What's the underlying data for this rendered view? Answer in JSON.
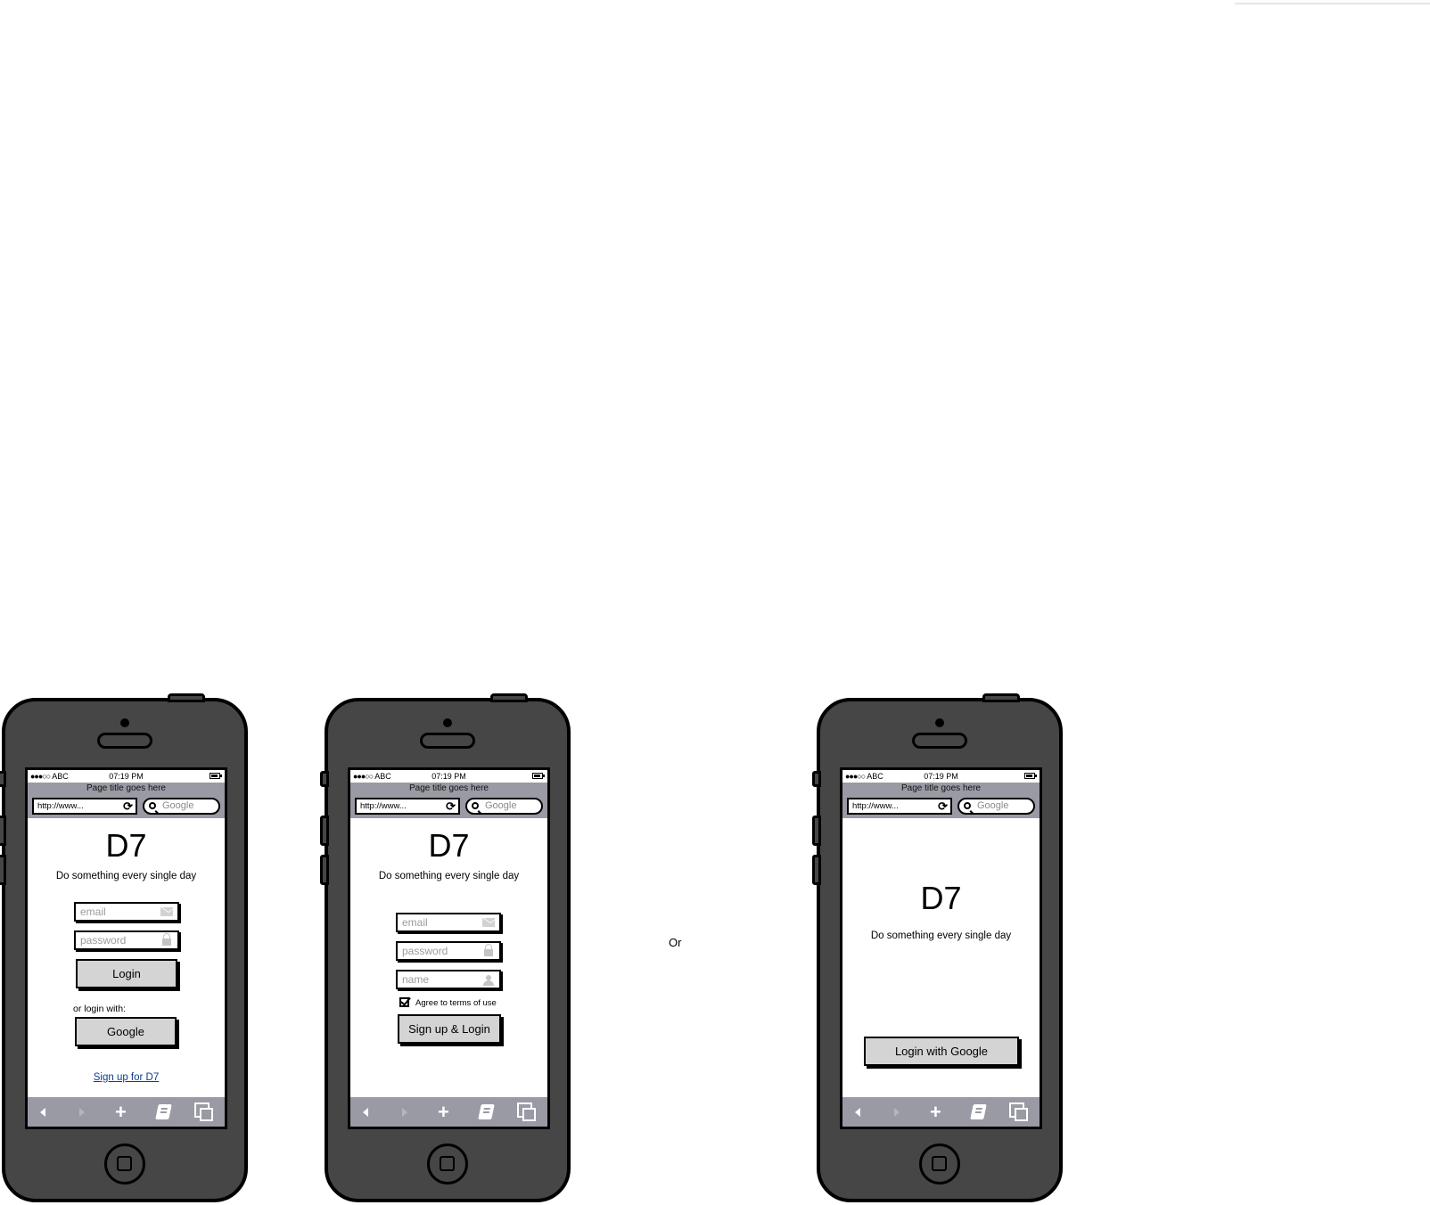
{
  "browser": {
    "carrier": "ABC",
    "signal": "●●●○○",
    "time": "07:19 PM",
    "page_title": "Page title goes here",
    "url": "http://www...",
    "search_placeholder": "Google"
  },
  "app": {
    "logo": "D7",
    "tagline": "Do something every single day"
  },
  "login_screen": {
    "email_placeholder": "email",
    "password_placeholder": "password",
    "login_label": "Login",
    "alt_login_text": "or login with:",
    "google_label": "Google",
    "signup_link": "Sign up for D7"
  },
  "signup_screen": {
    "email_placeholder": "email",
    "password_placeholder": "password",
    "name_placeholder": "name",
    "terms_label": "Agree to terms of use",
    "terms_checked": true,
    "submit_label": "Sign up & Login"
  },
  "separator": "Or",
  "google_screen": {
    "button_label": "Login with Google"
  }
}
